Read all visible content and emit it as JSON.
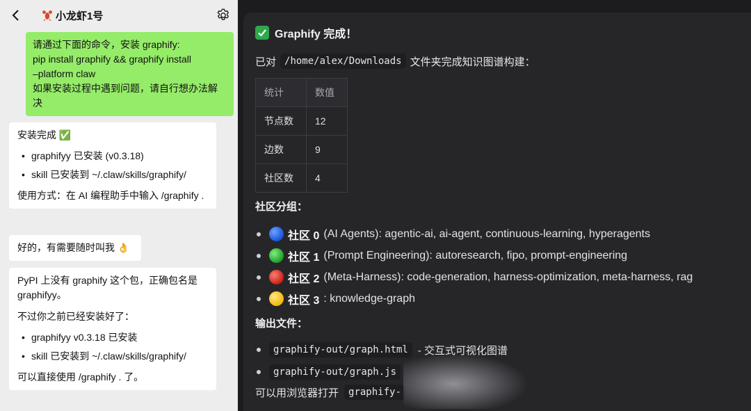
{
  "chat": {
    "title": "小龙虾1号",
    "outgoing": [
      "请通过下面的命令，安装 graphify:",
      "pip install graphify && graphify install",
      "–platform claw",
      "如果安装过程中遇到问题，请自行想办法解决"
    ],
    "msg1": {
      "head": "安装完成 ✅",
      "items": [
        "graphifyy 已安装 (v0.3.18)",
        "skill 已安装到 ~/.claw/skills/graphify/"
      ],
      "tail": "使用方式：在 AI 编程助手中输入 /graphify ."
    },
    "msg2": "好的，有需要随时叫我 👌",
    "msg3": {
      "head": "PyPI 上没有 graphify 这个包，正确包名是 graphifyy。",
      "sub": "不过你之前已经安装好了：",
      "items": [
        "graphifyy v0.3.18 已安装",
        "skill 已安装到 ~/.claw/skills/graphify/"
      ],
      "tail": "可以直接使用 /graphify . 了。"
    }
  },
  "result": {
    "title": "Graphify 完成！",
    "intro_pre": "已对",
    "intro_path": "/home/alex/Downloads",
    "intro_post": "文件夹完成知识图谱构建：",
    "table": {
      "headers": [
        "统计",
        "数值"
      ],
      "rows": [
        [
          "节点数",
          "12"
        ],
        [
          "边数",
          "9"
        ],
        [
          "社区数",
          "4"
        ]
      ]
    },
    "groups_title": "社区分组：",
    "groups": [
      {
        "name": "社区 0",
        "color": "#1a52d9",
        "desc": "(AI Agents): agentic-ai, ai-agent, continuous-learning, hyperagents"
      },
      {
        "name": "社区 1",
        "color": "#1f9e2a",
        "desc": "(Prompt Engineering): autoresearch, fipo, prompt-engineering"
      },
      {
        "name": "社区 2",
        "color": "#c8221b",
        "desc": "(Meta-Harness): code-generation, harness-optimization, meta-harness, rag"
      },
      {
        "name": "社区 3",
        "color": "#f0b90b",
        "desc": ": knowledge-graph"
      }
    ],
    "files_title": "输出文件：",
    "files": [
      {
        "path": "graphify-out/graph.html",
        "desc": "- 交互式可视化图谱"
      },
      {
        "path": "graphify-out/graph.js",
        "desc": ""
      }
    ],
    "last_pre": "可以用浏览器打开",
    "last_code": "graphify-"
  }
}
